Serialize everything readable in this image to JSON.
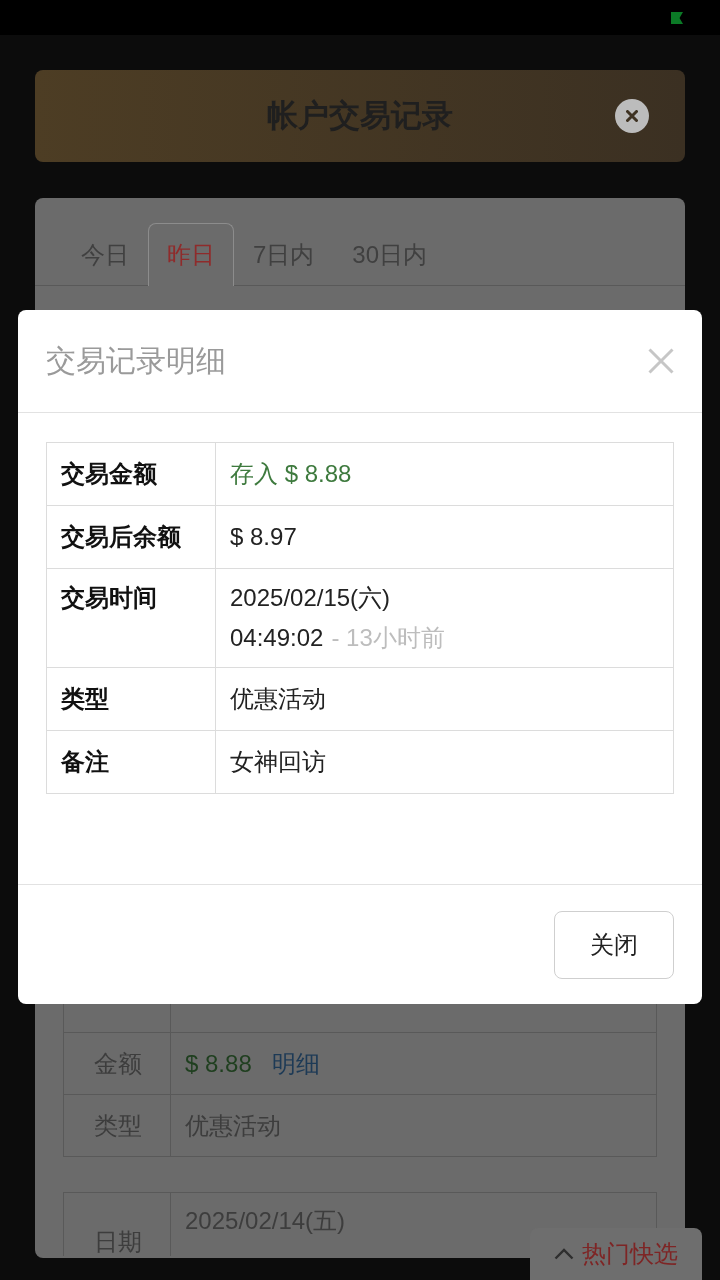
{
  "header": {
    "title": "帐户交易记录"
  },
  "tabs": [
    {
      "label": "今日",
      "selected": false
    },
    {
      "label": "昨日",
      "selected": true
    },
    {
      "label": "7日内",
      "selected": false
    },
    {
      "label": "30日内",
      "selected": false
    }
  ],
  "records": [
    {
      "rows": [
        {
          "kind": "amount",
          "label": "金额",
          "value": "$ 8.88",
          "link": "明细"
        },
        {
          "kind": "text",
          "label": "类型",
          "value": "优惠活动"
        }
      ]
    },
    {
      "rows": [
        {
          "kind": "text",
          "label": "日期",
          "value": "2025/02/14(五)"
        }
      ]
    }
  ],
  "detail_dialog": {
    "title": "交易记录明细",
    "rows": [
      {
        "kind": "amount",
        "label": "交易金额",
        "value": "存入 $ 8.88"
      },
      {
        "kind": "text",
        "label": "交易后余额",
        "value": "$ 8.97"
      },
      {
        "kind": "time",
        "label": "交易时间",
        "date": "2025/02/15(六)",
        "time": "04:49:02",
        "ago": "- 13小时前"
      },
      {
        "kind": "text",
        "label": "类型",
        "value": "优惠活动"
      },
      {
        "kind": "text",
        "label": "备注",
        "value": "女神回访"
      }
    ],
    "close_button": "关闭"
  },
  "quick_pick": {
    "label": "热门快选"
  }
}
